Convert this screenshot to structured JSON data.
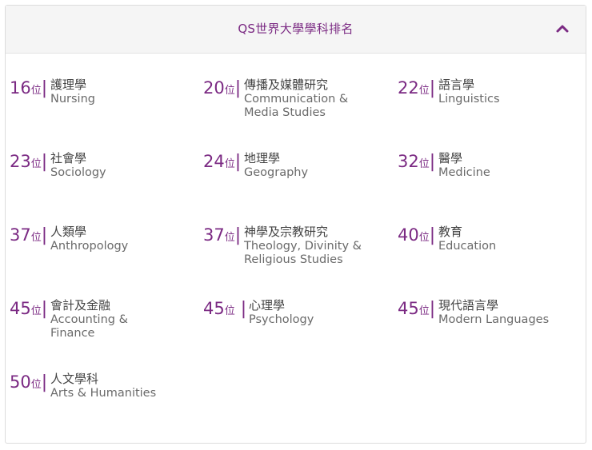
{
  "header": {
    "title": "QS世界大學學科排名",
    "collapse_icon": "chevron-up-icon",
    "accent_color": "#7b2a83"
  },
  "rank_suffix": "位",
  "rankings": [
    {
      "rank": "16",
      "zh": "護理學",
      "en": "Nursing"
    },
    {
      "rank": "20",
      "zh": "傳播及媒體研究",
      "en": "Communication & Media Studies"
    },
    {
      "rank": "22",
      "zh": "語言學",
      "en": "Linguistics"
    },
    {
      "rank": "23",
      "zh": "社會學",
      "en": "Sociology"
    },
    {
      "rank": "24",
      "zh": "地理學",
      "en": "Geography"
    },
    {
      "rank": "32",
      "zh": "醫學",
      "en": "Medicine"
    },
    {
      "rank": "37",
      "zh": "人類學",
      "en": "Anthropology"
    },
    {
      "rank": "37",
      "zh": "神學及宗教研究",
      "en": "Theology, Divinity & Religious Studies"
    },
    {
      "rank": "40",
      "zh": "教育",
      "en": "Education"
    },
    {
      "rank": "45",
      "zh": "會計及金融",
      "en": "Accounting & Finance"
    },
    {
      "rank": "45",
      "zh": "心理學",
      "en": "Psychology"
    },
    {
      "rank": "45",
      "zh": "現代語言學",
      "en": "Modern Languages"
    },
    {
      "rank": "50",
      "zh": "人文學科",
      "en": "Arts & Humanities"
    }
  ]
}
